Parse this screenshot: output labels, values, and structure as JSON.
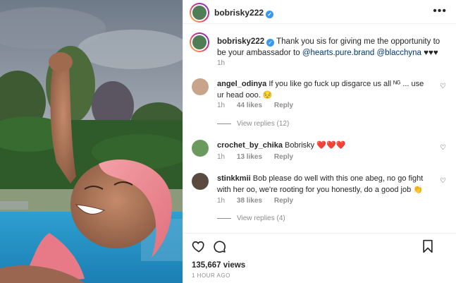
{
  "post": {
    "username": "bobrisky222",
    "caption": {
      "username": "bobrisky222",
      "text_before": "Thank you sis for giving me the opportunity to be your ambassador to ",
      "mention1": "@hearts.pure.brand",
      "mention2": "@blacchyna",
      "hearts": "♥♥♥",
      "time": "1h"
    },
    "comments": [
      {
        "username": "angel_odinya",
        "text": "If you like go fuck up disgarce us all ᴺᴳ ... use ur head ooo.",
        "emoji": "😔",
        "time": "1h",
        "likes": "44 likes",
        "reply": "Reply",
        "view_replies": "View replies (12)"
      },
      {
        "username": "crochet_by_chika",
        "text": "Bobrisky",
        "emoji": "❤️❤️❤️",
        "time": "1h",
        "likes": "13 likes",
        "reply": "Reply"
      },
      {
        "username": "stinkkmii",
        "text": "Bob please do well with this one abeg, no go fight with her oo, we're rooting for you honestly, do a good job",
        "emoji": "👏",
        "time": "1h",
        "likes": "38 likes",
        "reply": "Reply",
        "view_replies": "View replies (4)"
      }
    ],
    "like_count": "135,667 views",
    "posted_ago": "1 HOUR AGO",
    "more_label": "•••"
  },
  "colors": {
    "verified": "#3897f0",
    "mention": "#00376b",
    "muted": "#8e8e8e",
    "text": "#262626"
  },
  "icons": [
    "more-icon",
    "heart-icon",
    "comment-icon",
    "bookmark-icon",
    "verified-icon"
  ]
}
